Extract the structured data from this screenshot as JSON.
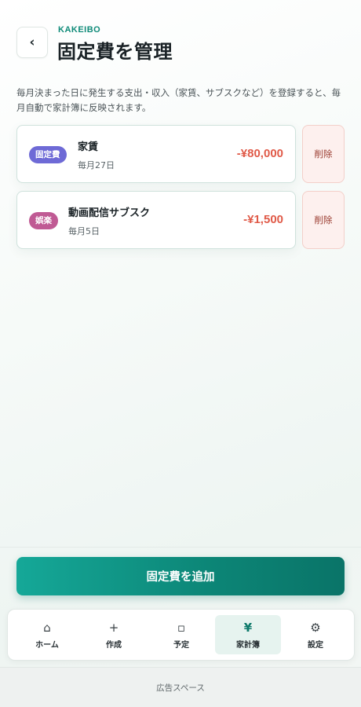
{
  "header": {
    "back_icon": "‹",
    "brand": "KAKEIBO",
    "title": "固定費を管理"
  },
  "description": "毎月決まった日に発生する支出・収入（家賃、サブスクなど）を登録すると、毎月自動で家計簿に反映されます。",
  "items": [
    {
      "category": "固定費",
      "name": "家賃",
      "schedule": "毎月27日",
      "amount": "-¥80,000",
      "delete_label": "削除"
    },
    {
      "category": "娯楽",
      "name": "動画配信サブスク",
      "schedule": "毎月5日",
      "amount": "-¥1,500",
      "delete_label": "削除"
    }
  ],
  "add_button": "固定費を追加",
  "tabs": [
    {
      "icon": "home-icon",
      "glyph": "⌂",
      "label": "ホーム"
    },
    {
      "icon": "plus-icon",
      "glyph": "+",
      "label": "作成"
    },
    {
      "icon": "square-icon",
      "glyph": "▫",
      "label": "予定"
    },
    {
      "icon": "yen-icon",
      "glyph": "¥",
      "label": "家計簿"
    },
    {
      "icon": "gear-icon",
      "glyph": "⚙",
      "label": "設定"
    }
  ],
  "active_tab": "家計簿",
  "ad_label": "広告スペース",
  "colors": {
    "accent": "#0e8a78",
    "expense": "#e05a48",
    "fixed_badge": "#6e6ad6",
    "entertainment_badge": "#c05a94"
  }
}
